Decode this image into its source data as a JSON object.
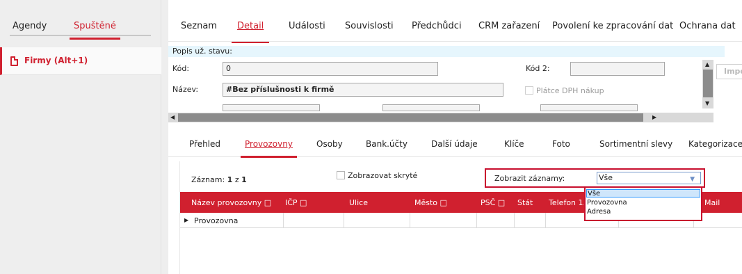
{
  "left_panel": {
    "tabs": [
      {
        "label": "Agendy"
      },
      {
        "label": "Spuštěné",
        "active": true
      }
    ],
    "items": [
      {
        "label": "Firmy (Alt+1)",
        "icon": "document-icon"
      }
    ]
  },
  "top_tabs": [
    {
      "label": "Seznam"
    },
    {
      "label": "Detail",
      "active": true
    },
    {
      "label": "Události"
    },
    {
      "label": "Souvislosti"
    },
    {
      "label": "Předchůdci"
    },
    {
      "label": "CRM zařazení"
    },
    {
      "label": "Povolení ke zpracování dat"
    },
    {
      "label": "Ochrana dat"
    }
  ],
  "form": {
    "popis_label": "Popis už. stavu:",
    "kod_label": "Kód:",
    "kod_value": "0",
    "kod2_label": "Kód 2:",
    "kod2_value": "",
    "nazev_label": "Název:",
    "nazev_value": "#Bez příslušnosti k firmě",
    "platce_label": "Plátce DPH nákup",
    "import_label": "Impo"
  },
  "sub_tabs": [
    {
      "label": "Přehled"
    },
    {
      "label": "Provozovny",
      "active": true
    },
    {
      "label": "Osoby"
    },
    {
      "label": "Bank.účty"
    },
    {
      "label": "Další údaje"
    },
    {
      "label": "Klíče"
    },
    {
      "label": "Foto"
    },
    {
      "label": "Sortimentní slevy"
    },
    {
      "label": "Kategorizace"
    }
  ],
  "grid": {
    "record_label": "Záznam:",
    "record_current": "1",
    "record_of": "z",
    "record_total": "1",
    "show_hidden_label": "Zobrazovat skryté",
    "show_records_label": "Zobrazit záznamy:",
    "show_records_value": "Vše",
    "columns": [
      {
        "label": "Název provozovny □"
      },
      {
        "label": "IČP □"
      },
      {
        "label": "Ulice"
      },
      {
        "label": "Město □"
      },
      {
        "label": "PSČ □"
      },
      {
        "label": "Stát"
      },
      {
        "label": "Telefon 1."
      },
      {
        "label": "Mail"
      }
    ],
    "rows": [
      {
        "name": "Provozovna"
      }
    ],
    "dropdown_options": [
      {
        "label": "Vše",
        "selected": true
      },
      {
        "label": "Provozovna"
      },
      {
        "label": "Adresa"
      }
    ]
  },
  "colors": {
    "accent": "#d0202f",
    "info_bg": "#e6f6fd"
  }
}
